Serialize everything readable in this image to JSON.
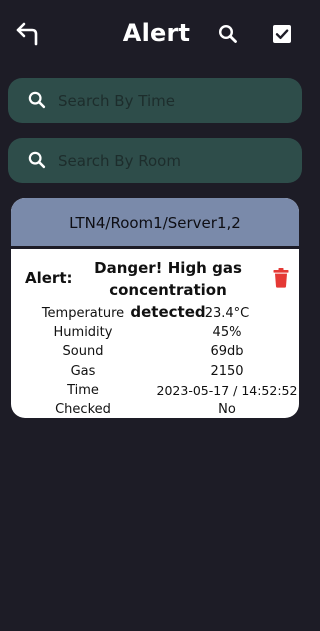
{
  "header": {
    "title": "Alert"
  },
  "search_time": {
    "placeholder": "Search By Time"
  },
  "search_room": {
    "placeholder": "Search By Room"
  },
  "alert_card": {
    "location": "LTN4/Room1/Server1,2",
    "alert_label": "Alert:",
    "message": "Danger! High gas concentration detected",
    "rows": [
      {
        "label": "Temperature",
        "value": "23.4°C"
      },
      {
        "label": "Humidity",
        "value": "45%"
      },
      {
        "label": "Sound",
        "value": "69db"
      },
      {
        "label": "Gas",
        "value": "2150"
      },
      {
        "label": "Time",
        "value": "2023-05-17 / 14:52:52"
      },
      {
        "label": "Checked",
        "value": "No"
      }
    ]
  },
  "icons": {
    "back": "back-arrow-icon",
    "search": "search-icon",
    "check": "checkbox-checked-icon",
    "delete": "trash-icon"
  },
  "colors": {
    "background": "#1d1c26",
    "search_bar": "#2e4d4a",
    "card_header": "#7a8aaa",
    "delete_icon": "#e53935"
  }
}
